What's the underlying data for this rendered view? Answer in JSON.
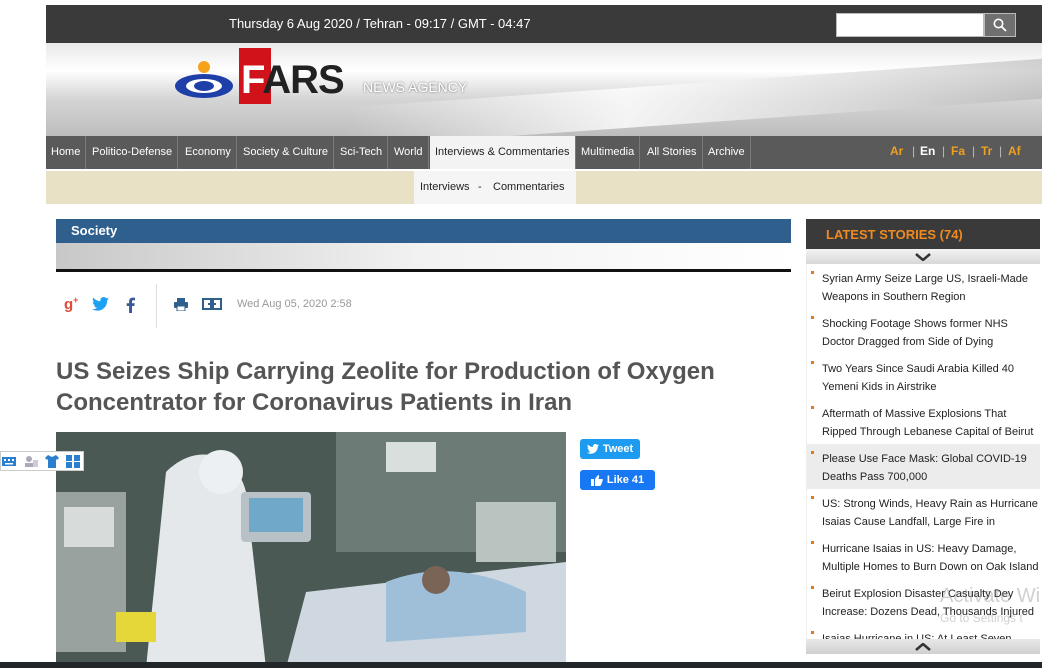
{
  "topbar": {
    "date_text": "Thursday 6 Aug 2020 / Tehran - 09:17 / GMT - 04:47",
    "search_placeholder": "",
    "search_icon": "magnifier-icon"
  },
  "logo": {
    "brand": "ARS",
    "brand_first": "F",
    "subtitle": "NEWS AGENCY"
  },
  "nav": {
    "items": [
      "Home",
      "Politico-Defense",
      "Economy",
      "Society & Culture",
      "Sci-Tech",
      "World",
      "Interviews & Commentaries",
      "Multimedia",
      "All Stories",
      "Archive"
    ],
    "active_index": 6,
    "languages": [
      "Ar",
      "En",
      "Fa",
      "Tr",
      "Af"
    ]
  },
  "subnav": {
    "item1": "Interviews",
    "sep": "-",
    "item2": "Commentaries"
  },
  "article": {
    "section": "Society",
    "timestamp": "Wed Aug 05, 2020 2:58",
    "headline_line1": "US Seizes Ship Carrying Zeolite for Production of Oxygen",
    "headline_line2": "Concentrator for Coronavirus Patients in Iran",
    "share_icons": [
      "google-plus-icon",
      "twitter-icon",
      "facebook-icon",
      "print-icon",
      "link-icon"
    ],
    "tweet_label": "Tweet",
    "like_label": "Like 41"
  },
  "latest": {
    "title": "LATEST STORIES (74)",
    "stories": [
      "Syrian Army Seize Large US, Israeli-Made Weapons in Southern Region",
      "Shocking Footage Shows former NHS Doctor Dragged from Side of Dying",
      "Two Years Since Saudi Arabia Killed 40 Yemeni Kids in Airstrike",
      "Aftermath of Massive Explosions That Ripped Through Lebanese Capital of Beirut",
      "Please Use Face Mask: Global COVID-19 Deaths Pass 700,000",
      "US: Strong Winds, Heavy Rain as Hurricane Isaias Cause Landfall, Large Fire in",
      "Hurricane Isaias in US: Heavy Damage, Multiple Homes to Burn Down on Oak Island",
      "Beirut Explosion Disaster Casualty Dey Increase: Dozens Dead, Thousands Injured",
      "Isaias Hurricane in US: At Least Seven"
    ],
    "highlighted_index": 4
  },
  "watermark": {
    "line1": "Activate Wi",
    "line2": "Go to Settings t"
  },
  "colors": {
    "section_blue": "#2e5f8d",
    "latest_orange": "#f08a1e",
    "nav_gray": "#5a5a5a"
  }
}
